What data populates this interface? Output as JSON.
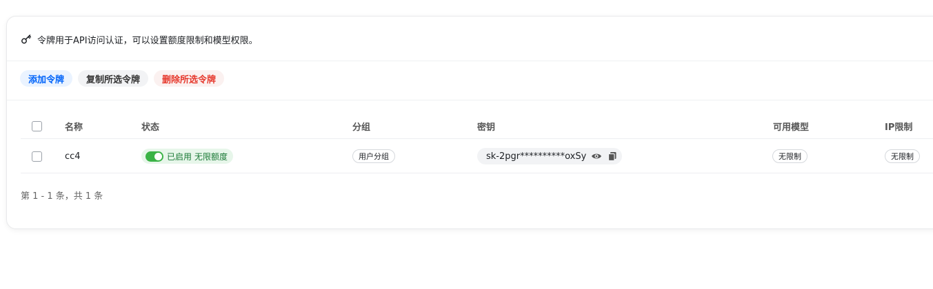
{
  "info": {
    "text": "令牌用于API访问认证，可以设置额度限制和模型权限。",
    "icon": "key-icon"
  },
  "toolbar": {
    "add_label": "添加令牌",
    "copy_label": "复制所选令牌",
    "delete_label": "删除所选令牌"
  },
  "table": {
    "columns": {
      "name": "名称",
      "status": "状态",
      "group": "分组",
      "key": "密钥",
      "models": "可用模型",
      "ip": "IP限制"
    },
    "rows": [
      {
        "name": "cc4",
        "status_enabled": "已启用",
        "status_quota": "无限额度",
        "group": "用户分组",
        "key": "sk-2pgr**********oxSy",
        "models": "无限制",
        "ip": "无限制"
      }
    ]
  },
  "pagination": {
    "summary": "第 1 - 1 条，共 1 条"
  },
  "colors": {
    "primary": "#0064fa",
    "danger": "#e6382c",
    "success": "#3bb346"
  }
}
